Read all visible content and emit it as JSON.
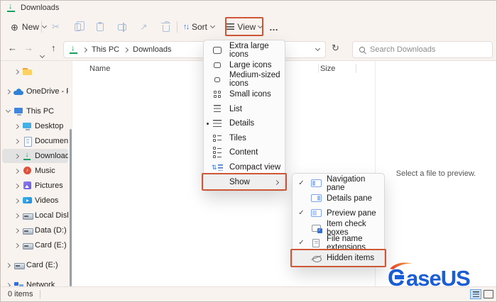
{
  "window": {
    "title": "Downloads"
  },
  "toolbar": {
    "new_label": "New",
    "sort_label": "Sort",
    "view_label": "View"
  },
  "address_bar": {
    "breadcrumb": [
      "This PC",
      "Downloads"
    ],
    "search_placeholder": "Search Downloads"
  },
  "sidebar": {
    "items": [
      {
        "label": "",
        "icon": "folder",
        "expanded": false,
        "indent": 1,
        "selected": false,
        "gap": false
      },
      {
        "label": "OneDrive - Persona",
        "icon": "cloud",
        "expanded": false,
        "indent": 0,
        "selected": false,
        "gap": true
      },
      {
        "label": "This PC",
        "icon": "this-pc",
        "expanded": true,
        "indent": 0,
        "selected": false,
        "gap": true
      },
      {
        "label": "Desktop",
        "icon": "desktop",
        "expanded": false,
        "indent": 1,
        "selected": false,
        "gap": false
      },
      {
        "label": "Documents",
        "icon": "documents",
        "expanded": false,
        "indent": 1,
        "selected": false,
        "gap": false
      },
      {
        "label": "Downloads",
        "icon": "downloads",
        "expanded": false,
        "indent": 1,
        "selected": true,
        "gap": false
      },
      {
        "label": "Music",
        "icon": "music",
        "expanded": false,
        "indent": 1,
        "selected": false,
        "gap": false
      },
      {
        "label": "Pictures",
        "icon": "pictures",
        "expanded": false,
        "indent": 1,
        "selected": false,
        "gap": false
      },
      {
        "label": "Videos",
        "icon": "videos",
        "expanded": false,
        "indent": 1,
        "selected": false,
        "gap": false
      },
      {
        "label": "Local Disk (C:)",
        "icon": "disk",
        "expanded": false,
        "indent": 1,
        "selected": false,
        "gap": false
      },
      {
        "label": "Data (D:)",
        "icon": "disk",
        "expanded": false,
        "indent": 1,
        "selected": false,
        "gap": false
      },
      {
        "label": "Card (E:)",
        "icon": "disk",
        "expanded": false,
        "indent": 1,
        "selected": false,
        "gap": false
      },
      {
        "label": "Card (E:)",
        "icon": "disk",
        "expanded": false,
        "indent": 0,
        "selected": false,
        "gap": true
      },
      {
        "label": "Network",
        "icon": "network",
        "expanded": false,
        "indent": 0,
        "selected": false,
        "gap": true
      }
    ]
  },
  "list": {
    "columns": [
      "Name",
      "Size"
    ]
  },
  "preview_pane": {
    "placeholder": "Select a file to preview."
  },
  "status_bar": {
    "item_count": "0 items"
  },
  "view_menu": {
    "items": [
      {
        "label": "Extra large icons",
        "icon": "extra-large-icons",
        "selected": false,
        "submenu": false,
        "highlighted": false
      },
      {
        "label": "Large icons",
        "icon": "large-icons",
        "selected": false,
        "submenu": false,
        "highlighted": false
      },
      {
        "label": "Medium-sized icons",
        "icon": "medium-icons",
        "selected": false,
        "submenu": false,
        "highlighted": false
      },
      {
        "label": "Small icons",
        "icon": "small-icons",
        "selected": false,
        "submenu": false,
        "highlighted": false
      },
      {
        "label": "List",
        "icon": "list-view",
        "selected": false,
        "submenu": false,
        "highlighted": false
      },
      {
        "label": "Details",
        "icon": "details-view",
        "selected": true,
        "submenu": false,
        "highlighted": false
      },
      {
        "label": "Tiles",
        "icon": "tiles-view",
        "selected": false,
        "submenu": false,
        "highlighted": false
      },
      {
        "label": "Content",
        "icon": "content-view",
        "selected": false,
        "submenu": false,
        "highlighted": false
      },
      {
        "label": "Compact view",
        "icon": "compact-view",
        "selected": false,
        "submenu": false,
        "highlighted": false
      },
      {
        "label": "Show",
        "icon": "",
        "selected": false,
        "submenu": true,
        "highlighted": true
      }
    ]
  },
  "show_submenu": {
    "items": [
      {
        "label": "Navigation pane",
        "icon": "navigation-pane",
        "checked": true,
        "highlighted": false
      },
      {
        "label": "Details pane",
        "icon": "details-pane",
        "checked": false,
        "highlighted": false
      },
      {
        "label": "Preview pane",
        "icon": "preview-pane",
        "checked": true,
        "highlighted": false
      },
      {
        "label": "Item check boxes",
        "icon": "item-check-boxes",
        "checked": false,
        "highlighted": false
      },
      {
        "label": "File name extensions",
        "icon": "file-name-extensions",
        "checked": true,
        "highlighted": false
      },
      {
        "label": "Hidden items",
        "icon": "hidden-items",
        "checked": false,
        "highlighted": true
      }
    ]
  },
  "logo": {
    "text": "aseUS"
  },
  "colors": {
    "highlight_box": "#cf5736",
    "accent_blue": "#1a5dd4",
    "download_green": "#17a05e"
  }
}
